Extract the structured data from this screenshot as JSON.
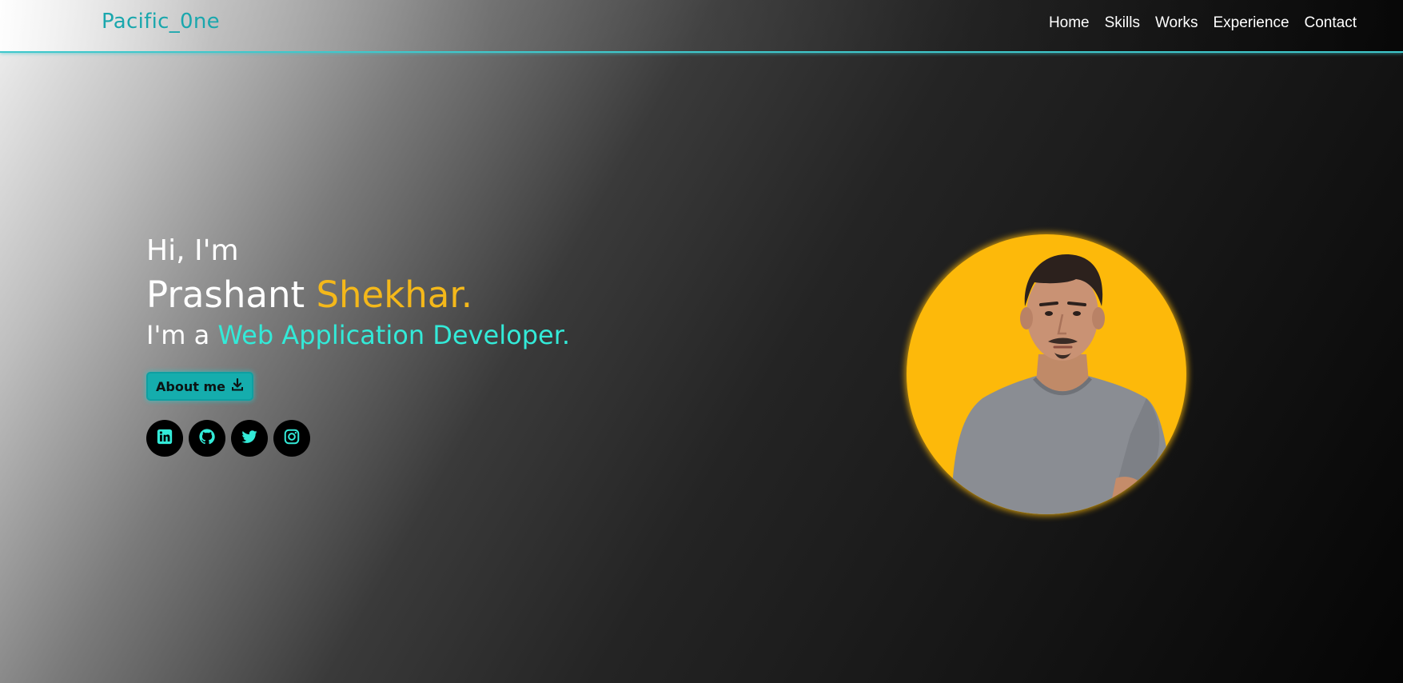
{
  "header": {
    "brand": "Pacific_0ne",
    "nav": [
      "Home",
      "Skills",
      "Works",
      "Experience",
      "Contact"
    ]
  },
  "hero": {
    "greeting": "Hi, I'm",
    "first_name": "Prashant ",
    "last_name": "Shekhar.",
    "role_prefix": "I'm a ",
    "role_title": "Web Application Developer.",
    "about_button": "About me",
    "about_icon": "download-icon",
    "socials": [
      "linkedin-icon",
      "github-icon",
      "twitter-icon",
      "instagram-icon"
    ]
  },
  "colors": {
    "brand": "#1aa7ad",
    "accent_yellow": "#f4b81a",
    "accent_cyan": "#33ead8",
    "button_bg": "#15adad",
    "avatar_bg": "#fdb90a",
    "social_icon": "#33ead8"
  }
}
